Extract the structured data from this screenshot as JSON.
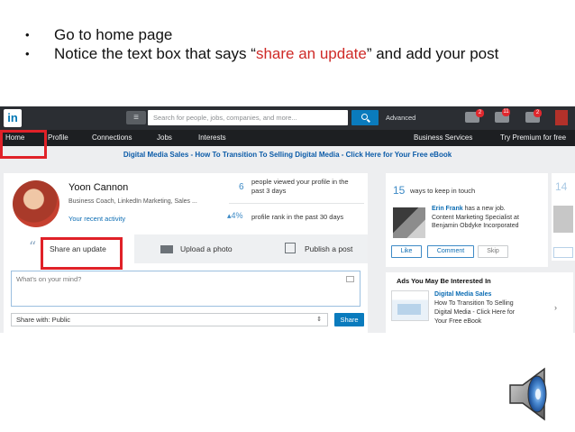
{
  "bullets": [
    {
      "text": "Go to home page"
    },
    {
      "before": "Notice the text box that says “",
      "highlight": "share an update",
      "after": "” and add your post"
    }
  ],
  "linkedin": {
    "logo": "in",
    "search_placeholder": "Search for people, jobs, companies, and more...",
    "advanced_label": "Advanced",
    "notification_badges": [
      "2",
      "11",
      "2"
    ],
    "nav": {
      "home": "Home",
      "profile": "Profile",
      "connections": "Connections",
      "jobs": "Jobs",
      "interests": "Interests",
      "business_services": "Business Services",
      "premium": "Try Premium for free"
    },
    "promo": {
      "brand": "Digital Media Sales",
      "text_before": " - How To Transition To Selling Digital Media - ",
      "link": "Click Here",
      "text_after": " for Your Free eBook"
    },
    "profile": {
      "name": "Yoon Cannon",
      "subtitle": "Business Coach, LinkedIn Marketing, Sales ...",
      "activity_link": "Your recent activity",
      "views_count": "6",
      "views_text_1": "people viewed your profile in the",
      "views_text_2": "past 3 days",
      "rank_change": "▴4%",
      "rank_text": "profile rank in the past 30 days"
    },
    "tabs": {
      "share": "Share an update",
      "upload": "Upload a photo",
      "publish": "Publish a post"
    },
    "composer": {
      "placeholder": "What's on your mind?",
      "share_with": "Share with: Public",
      "share_button": "Share"
    },
    "keep_in_touch": {
      "count": "15",
      "label": "ways to keep in touch",
      "person_name": "Erin Frank",
      "line1_rest": " has a new job.",
      "line2": "Content Marketing Specialist at",
      "line3": "Benjamin Obdyke Incorporated",
      "like": "Like",
      "comment": "Comment",
      "skip": "Skip"
    },
    "ads": {
      "title": "Ads You May Be Interested In",
      "headline": "Digital Media Sales",
      "line1": "How To Transition To Selling",
      "line2": "Digital Media - Click Here for",
      "line3": "Your Free eBook"
    },
    "peek_count": "14"
  },
  "colors": {
    "highlight": "#cf2a27",
    "linkedin_blue": "#0a7bbd",
    "callout_red": "#e02128"
  }
}
